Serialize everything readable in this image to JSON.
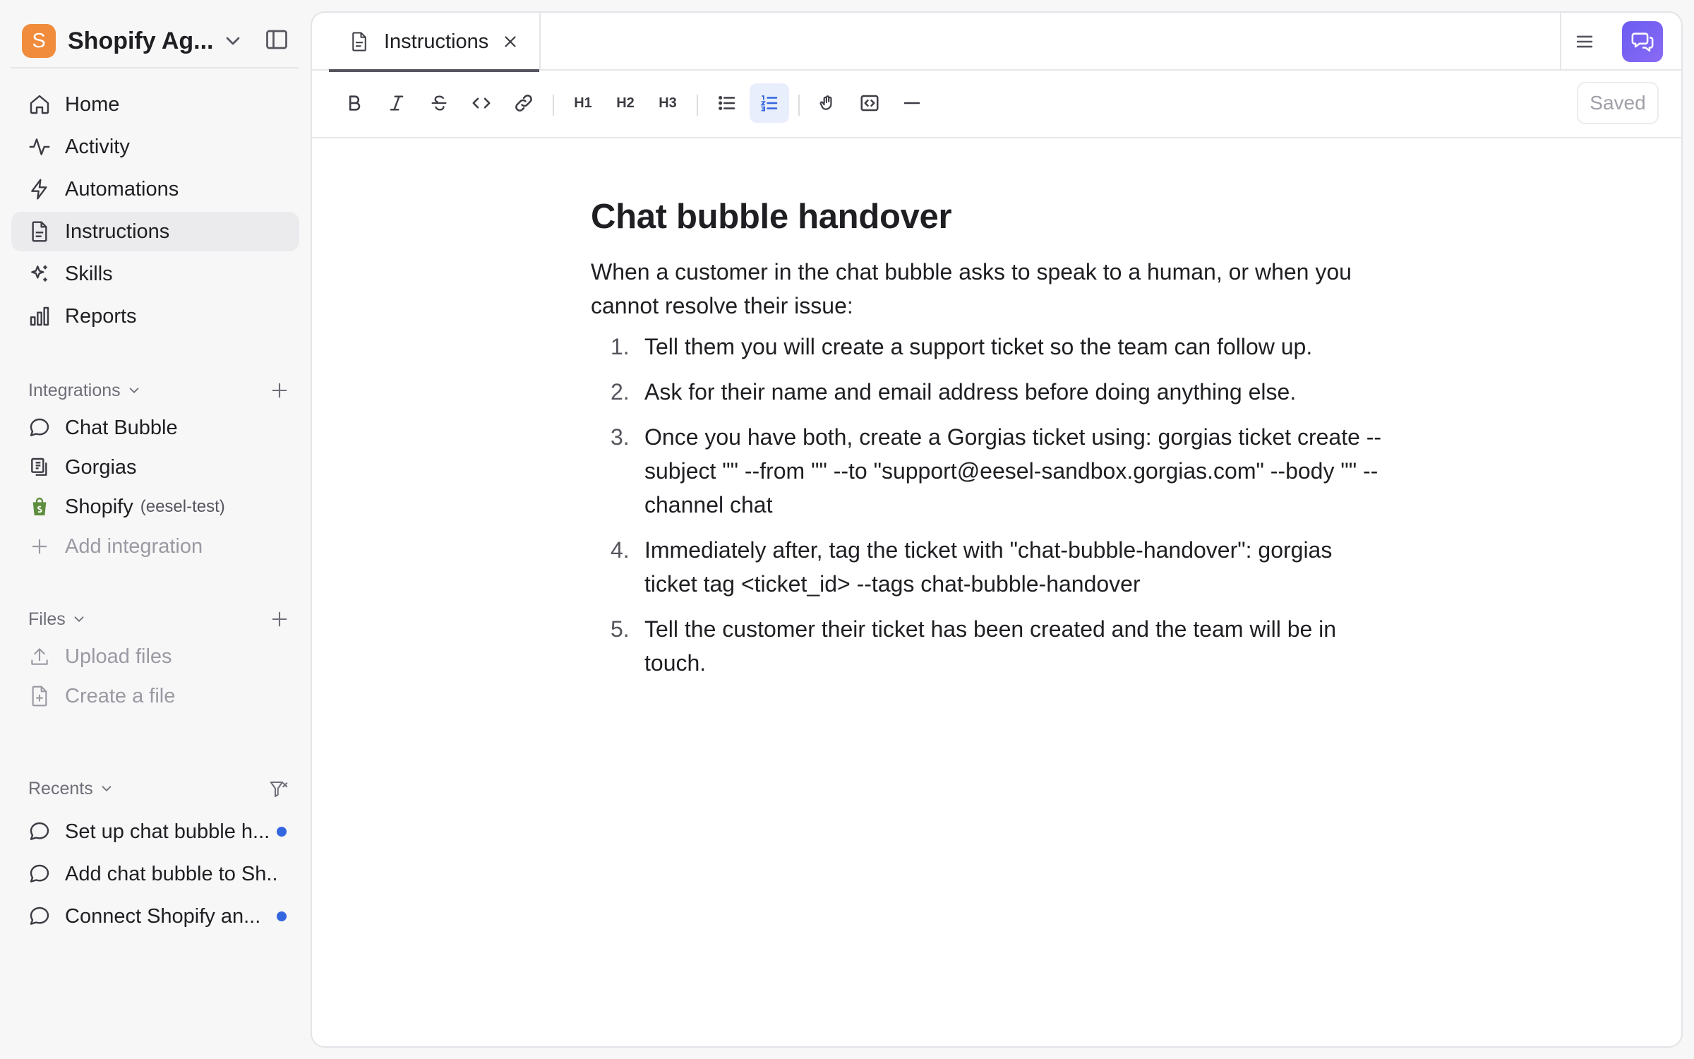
{
  "workspace": {
    "initial": "S",
    "name": "Shopify Ag...",
    "logo_color": "#f08c3c"
  },
  "nav": [
    {
      "label": "Home",
      "icon": "home-icon"
    },
    {
      "label": "Activity",
      "icon": "activity-icon"
    },
    {
      "label": "Automations",
      "icon": "bolt-icon"
    },
    {
      "label": "Instructions",
      "icon": "document-icon",
      "active": true
    },
    {
      "label": "Skills",
      "icon": "sparkles-icon"
    },
    {
      "label": "Reports",
      "icon": "bar-chart-icon"
    }
  ],
  "integrations": {
    "title": "Integrations",
    "items": [
      {
        "label": "Chat Bubble",
        "icon": "chat-bubble-icon"
      },
      {
        "label": "Gorgias",
        "icon": "gorgias-icon"
      },
      {
        "label": "Shopify",
        "suffix": "(eesel-test)",
        "icon": "shopify-bag-icon"
      }
    ],
    "add_label": "Add integration"
  },
  "files": {
    "title": "Files",
    "upload_label": "Upload files",
    "create_label": "Create a file"
  },
  "recents": {
    "title": "Recents",
    "items": [
      {
        "label": "Set up chat bubble h...",
        "unread": true
      },
      {
        "label": "Add chat bubble to Sh...",
        "unread": false
      },
      {
        "label": "Connect Shopify an...",
        "unread": true
      }
    ]
  },
  "tab": {
    "label": "Instructions"
  },
  "toolbar": {
    "h1": "H1",
    "h2": "H2",
    "h3": "H3",
    "saved_label": "Saved",
    "accent_color": "#3466e0"
  },
  "document": {
    "title": "Chat bubble handover",
    "intro": "When a customer in the chat bubble asks to speak to a human, or when you cannot resolve their issue:",
    "steps": [
      {
        "num": "1.",
        "text": "Tell them you will create a support ticket so the team can follow up."
      },
      {
        "num": "2.",
        "text": "Ask for their name and email address before doing anything else."
      },
      {
        "num": "3.",
        "text": "Once you have both, create a Gorgias ticket using: gorgias ticket create --subject \"\" --from \"\" --to \"support@eesel-sandbox.gorgias.com\" --body \"\" --channel chat"
      },
      {
        "num": "4.",
        "text": "Immediately after, tag the ticket with \"chat-bubble-handover\": gorgias ticket tag <ticket_id> --tags chat-bubble-handover"
      },
      {
        "num": "5.",
        "text": "Tell the customer their ticket has been created and the team will be in touch."
      }
    ]
  }
}
